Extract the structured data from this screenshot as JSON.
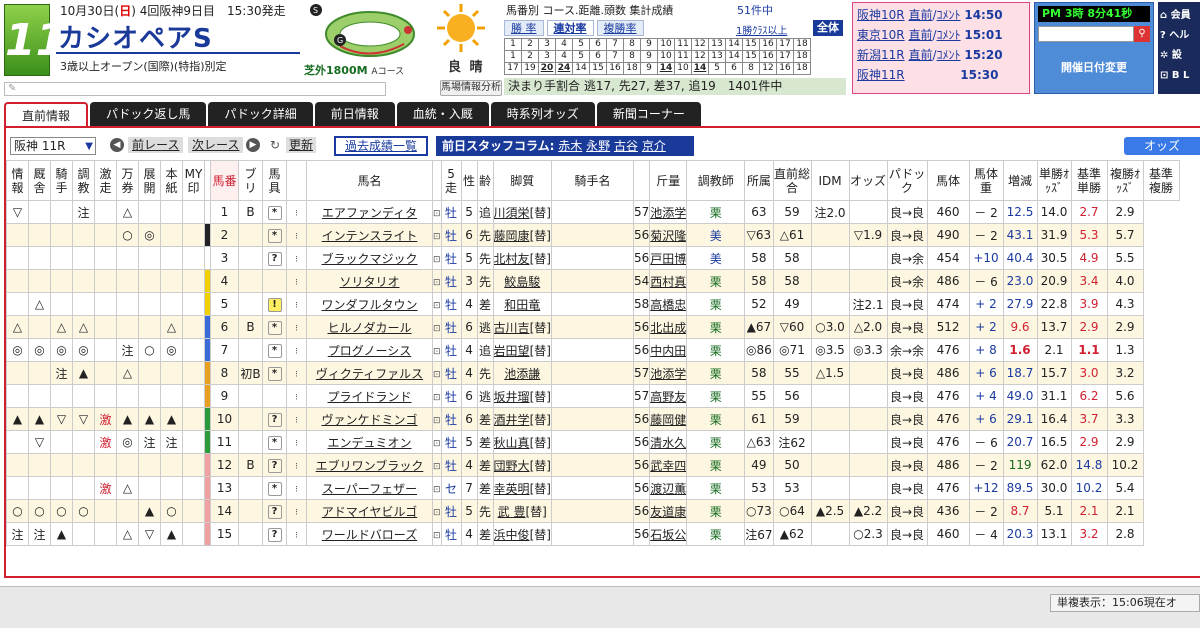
{
  "header": {
    "race_number": "11",
    "date_prefix": "10月30日(",
    "day": "日",
    "date_suffix": ") 4回阪神9日目　15:30発走",
    "race_name": "カシオペアS",
    "condition": "3歳以上オープン(国際)(特指)別定",
    "course": "芝外1800M",
    "course_sub": "Aコース",
    "weather": "良 晴"
  },
  "stats": {
    "heading": "馬番別 コース.距離.頭数 集計成績",
    "count": "51件中",
    "tabs": [
      "勝 率",
      "連対率",
      "複勝率"
    ],
    "class_link": "1勝ｸﾗｽ以上",
    "all_label": "全体",
    "grid_row1": [
      "1",
      "2",
      "3",
      "4",
      "5",
      "6",
      "7",
      "8",
      "9",
      "10",
      "11",
      "12",
      "13",
      "14",
      "15",
      "16",
      "17",
      "18"
    ],
    "grid_row2": [
      "1",
      "2",
      "3",
      "4",
      "5",
      "6",
      "7",
      "8",
      "9",
      "10",
      "11",
      "12",
      "13",
      "14",
      "15",
      "16",
      "17",
      "18"
    ],
    "grid_row3": [
      "17",
      "19",
      "20",
      "24",
      "14",
      "15",
      "16",
      "18",
      "9",
      "14",
      "10",
      "14",
      "5",
      "6",
      "8",
      "12",
      "16",
      "18"
    ],
    "pace": "決まり手割合 逃17, 先27, 差37, 追19　1401件中",
    "baba_button": "馬場情報分析"
  },
  "race_links": [
    {
      "track": "阪神10R",
      "a": "直前",
      "b": "ｺﾒﾝﾄ",
      "time": "14:50"
    },
    {
      "track": "東京10R",
      "a": "直前",
      "b": "ｺﾒﾝﾄ",
      "time": "15:01"
    },
    {
      "track": "新潟11R",
      "a": "直前",
      "b": "ｺﾒﾝﾄ",
      "time": "15:20"
    },
    {
      "track": "阪神11R",
      "a": "",
      "b": "",
      "time": "15:30"
    }
  ],
  "clock": "PM 3時 8分41秒",
  "date_change": "開催日付変更",
  "side_menu": [
    "⌂ 会員",
    "? ヘル",
    "✲ 設",
    "⊡ B L"
  ],
  "tabs": [
    "直前情報",
    "パドック返し馬",
    "パドック詳細",
    "前日情報",
    "血統・入厩",
    "時系列オッズ",
    "新聞コーナー"
  ],
  "toolbar": {
    "race_select": "阪神 11R",
    "prev": "前レース",
    "next": "次レース",
    "refresh": "更新",
    "past": "過去成績一覧",
    "staff_label": "前日スタッフコラム:",
    "staff": [
      "赤木",
      "永野",
      "古谷",
      "京介"
    ],
    "odds": "オッズ"
  },
  "table_headers": [
    "情報",
    "厩舎",
    "騎手",
    "調教",
    "激走",
    "万券",
    "展開",
    "本紙",
    "MY印",
    "",
    "馬番",
    "ブリ",
    "馬具",
    "",
    "馬名",
    "",
    "5走",
    "性",
    "齢",
    "脚質",
    "騎手名",
    "",
    "斤量",
    "調教師",
    "所属",
    "直前総合",
    "IDM",
    "オッズ",
    "パドック",
    "馬体",
    "馬体重",
    "増減",
    "単勝ｵｯｽﾞ",
    "基準単勝",
    "複勝ｵｯｽﾞ",
    "基準複勝"
  ],
  "rows": [
    {
      "m": [
        "▽",
        "",
        "",
        "注",
        "",
        "△",
        "",
        "",
        ""
      ],
      "waku": "#ffffff",
      "no": "1",
      "bl": "B",
      "k": "*",
      "name": "エアファンディタ",
      "sex": "牡",
      "age": "5",
      "style": "追",
      "jockey": "川須栄",
      "jt": "替",
      "kin": "57",
      "trainer": "池添学",
      "tb": "栗",
      "sogo": "63",
      "idm": "59",
      "odds": "注2.0",
      "pad": "",
      "body": "良→良",
      "weight": "460",
      "diff": "－ 2",
      "win": "12.5",
      "bwin": "14.0",
      "place": "2.7",
      "bplace": "2.9",
      "wc": "blue",
      "pc": "red"
    },
    {
      "m": [
        "",
        "",
        "",
        "",
        "",
        "○",
        "◎",
        "",
        ""
      ],
      "waku": "#222222",
      "no": "2",
      "bl": "",
      "k": "*",
      "name": "インテンスライト",
      "sex": "牡",
      "age": "6",
      "style": "先",
      "jockey": "藤岡康",
      "jt": "替",
      "kin": "56",
      "trainer": "菊沢隆",
      "tb": "美",
      "sogo": "▽63",
      "idm": "△61",
      "odds": "",
      "pad": "▽1.9",
      "body": "良→良",
      "weight": "490",
      "diff": "－ 2",
      "win": "43.1",
      "bwin": "31.9",
      "place": "5.3",
      "bplace": "5.7",
      "wc": "blue",
      "pc": "red"
    },
    {
      "m": [
        "",
        "",
        "",
        "",
        "",
        "",
        "",
        "",
        ""
      ],
      "waku": "#ffffff",
      "no": "3",
      "bl": "",
      "k": "?",
      "name": "ブラックマジック",
      "sex": "牡",
      "age": "5",
      "style": "先",
      "jockey": "北村友",
      "jt": "替",
      "kin": "56",
      "trainer": "戸田博",
      "tb": "美",
      "sogo": "58",
      "idm": "58",
      "odds": "",
      "pad": "",
      "body": "良→余",
      "weight": "454",
      "diff": "+10",
      "win": "40.4",
      "bwin": "30.5",
      "place": "4.9",
      "bplace": "5.5",
      "wc": "blue",
      "pc": "red"
    },
    {
      "m": [
        "",
        "",
        "",
        "",
        "",
        "",
        "",
        "",
        ""
      ],
      "waku": "#f0d000",
      "no": "4",
      "bl": "",
      "k": "",
      "name": "ソリタリオ",
      "sex": "牡",
      "age": "3",
      "style": "先",
      "jockey": "鮫島駿",
      "jt": "",
      "kin": "54",
      "trainer": "西村真",
      "tb": "栗",
      "sogo": "58",
      "idm": "58",
      "odds": "",
      "pad": "",
      "body": "良→余",
      "weight": "486",
      "diff": "－ 6",
      "win": "23.0",
      "bwin": "20.9",
      "place": "3.4",
      "bplace": "4.0",
      "wc": "blue",
      "pc": "red"
    },
    {
      "m": [
        "",
        "△",
        "",
        "",
        "",
        "",
        "",
        "",
        ""
      ],
      "waku": "#f0d000",
      "no": "5",
      "bl": "",
      "k": "!",
      "name": "ワンダフルタウン",
      "sex": "牡",
      "age": "4",
      "style": "差",
      "jockey": "和田竜",
      "jt": "",
      "kin": "58",
      "trainer": "高橋忠",
      "tb": "栗",
      "sogo": "52",
      "idm": "49",
      "odds": "",
      "pad": "注2.1",
      "body": "良→良",
      "weight": "474",
      "diff": "+ 2",
      "win": "27.9",
      "bwin": "22.8",
      "place": "3.9",
      "bplace": "4.3",
      "wc": "blue",
      "pc": "red"
    },
    {
      "m": [
        "△",
        "",
        "△",
        "△",
        "",
        "",
        "",
        "△",
        ""
      ],
      "waku": "#3a6ad8",
      "no": "6",
      "bl": "B",
      "k": "*",
      "name": "ヒルノダカール",
      "sex": "牡",
      "age": "6",
      "style": "逃",
      "jockey": "古川吉",
      "jt": "替",
      "kin": "56",
      "trainer": "北出成",
      "tb": "栗",
      "sogo": "▲67",
      "idm": "▽60",
      "odds": "○3.0",
      "pad": "△2.0",
      "body": "良→良",
      "weight": "512",
      "diff": "+ 2",
      "win": "9.6",
      "bwin": "13.7",
      "place": "2.9",
      "bplace": "2.9",
      "wc": "red",
      "pc": "red"
    },
    {
      "m": [
        "◎",
        "◎",
        "◎",
        "◎",
        "",
        "注",
        "○",
        "◎",
        ""
      ],
      "waku": "#3a6ad8",
      "no": "7",
      "bl": "",
      "k": "*",
      "name": "プログノーシス",
      "sex": "牡",
      "age": "4",
      "style": "追",
      "jockey": "岩田望",
      "jt": "替",
      "kin": "56",
      "trainer": "中内田",
      "tb": "栗",
      "sogo": "◎86",
      "idm": "◎71",
      "odds": "◎3.5",
      "pad": "◎3.3",
      "body": "余→余",
      "weight": "476",
      "diff": "+ 8",
      "win": "1.6",
      "bwin": "2.1",
      "place": "1.1",
      "bplace": "1.3",
      "wc": "redb",
      "pc": "redb"
    },
    {
      "m": [
        "",
        "",
        "注",
        "▲",
        "",
        "△",
        "",
        "",
        ""
      ],
      "waku": "#e8a020",
      "no": "8",
      "bl": "初B",
      "k": "*",
      "name": "ヴィクティファルス",
      "sex": "牡",
      "age": "4",
      "style": "先",
      "jockey": "池添謙",
      "jt": "",
      "kin": "57",
      "trainer": "池添学",
      "tb": "栗",
      "sogo": "58",
      "idm": "55",
      "odds": "△1.5",
      "pad": "",
      "body": "良→良",
      "weight": "486",
      "diff": "+ 6",
      "win": "18.7",
      "bwin": "15.7",
      "place": "3.0",
      "bplace": "3.2",
      "wc": "blue",
      "pc": "red"
    },
    {
      "m": [
        "",
        "",
        "",
        "",
        "",
        "",
        "",
        "",
        ""
      ],
      "waku": "#e8a020",
      "no": "9",
      "bl": "",
      "k": "",
      "name": "プライドランド",
      "sex": "牡",
      "age": "6",
      "style": "逃",
      "jockey": "坂井瑠",
      "jt": "替",
      "kin": "57",
      "trainer": "高野友",
      "tb": "栗",
      "sogo": "55",
      "idm": "56",
      "odds": "",
      "pad": "",
      "body": "良→良",
      "weight": "476",
      "diff": "+ 4",
      "win": "49.0",
      "bwin": "31.1",
      "place": "6.2",
      "bplace": "5.6",
      "wc": "blue",
      "pc": "red"
    },
    {
      "m": [
        "▲",
        "▲",
        "▽",
        "▽",
        "激",
        "▲",
        "▲",
        "▲",
        ""
      ],
      "waku": "#2a9a3a",
      "no": "10",
      "bl": "",
      "k": "?",
      "name": "ヴァンケドミンゴ",
      "sex": "牡",
      "age": "6",
      "style": "差",
      "jockey": "酒井学",
      "jt": "替",
      "kin": "56",
      "trainer": "藤岡健",
      "tb": "栗",
      "sogo": "61",
      "idm": "59",
      "odds": "",
      "pad": "",
      "body": "良→良",
      "weight": "476",
      "diff": "+ 6",
      "win": "29.1",
      "bwin": "16.4",
      "place": "3.7",
      "bplace": "3.3",
      "wc": "blue",
      "pc": "red"
    },
    {
      "m": [
        "",
        "▽",
        "",
        "",
        "激",
        "◎",
        "注",
        "注",
        ""
      ],
      "waku": "#2a9a3a",
      "no": "11",
      "bl": "",
      "k": "*",
      "name": "エンデュミオン",
      "sex": "牡",
      "age": "5",
      "style": "差",
      "jockey": "秋山真",
      "jt": "替",
      "kin": "56",
      "trainer": "清水久",
      "tb": "栗",
      "sogo": "△63",
      "idm": "注62",
      "odds": "",
      "pad": "",
      "body": "良→良",
      "weight": "476",
      "diff": "－ 6",
      "win": "20.7",
      "bwin": "16.5",
      "place": "2.9",
      "bplace": "2.9",
      "wc": "blue",
      "pc": "red"
    },
    {
      "m": [
        "",
        "",
        "",
        "",
        "",
        "",
        "",
        "",
        ""
      ],
      "waku": "#f0a0a0",
      "no": "12",
      "bl": "B",
      "k": "?",
      "name": "エブリワンブラック",
      "sex": "牡",
      "age": "4",
      "style": "差",
      "jockey": "団野大",
      "jt": "替",
      "kin": "56",
      "trainer": "武幸四",
      "tb": "栗",
      "sogo": "49",
      "idm": "50",
      "odds": "",
      "pad": "",
      "body": "良→良",
      "weight": "486",
      "diff": "－ 2",
      "win": "119",
      "bwin": "62.0",
      "place": "14.8",
      "bplace": "10.2",
      "wc": "green",
      "pc": "blue"
    },
    {
      "m": [
        "",
        "",
        "",
        "",
        "激",
        "△",
        "",
        "",
        ""
      ],
      "waku": "#f0a0a0",
      "no": "13",
      "bl": "",
      "k": "*",
      "name": "スーパーフェザー",
      "sex": "セ",
      "age": "7",
      "style": "差",
      "jockey": "幸英明",
      "jt": "替",
      "kin": "56",
      "trainer": "渡辺薫",
      "tb": "栗",
      "sogo": "53",
      "idm": "53",
      "odds": "",
      "pad": "",
      "body": "良→良",
      "weight": "476",
      "diff": "+12",
      "win": "89.5",
      "bwin": "30.0",
      "place": "10.2",
      "bplace": "5.4",
      "wc": "blue",
      "pc": "blue"
    },
    {
      "m": [
        "○",
        "○",
        "○",
        "○",
        "",
        "",
        "▲",
        "○",
        ""
      ],
      "waku": "#f0a0a0",
      "no": "14",
      "bl": "",
      "k": "?",
      "name": "アドマイヤビルゴ",
      "sex": "牡",
      "age": "5",
      "style": "先",
      "jockey": "武 豊",
      "jt": "替",
      "kin": "56",
      "trainer": "友道康",
      "tb": "栗",
      "sogo": "○73",
      "idm": "○64",
      "odds": "▲2.5",
      "pad": "▲2.2",
      "body": "良→良",
      "weight": "436",
      "diff": "－ 2",
      "win": "8.7",
      "bwin": "5.1",
      "place": "2.1",
      "bplace": "2.1",
      "wc": "red",
      "pc": "red"
    },
    {
      "m": [
        "注",
        "注",
        "▲",
        "",
        "",
        "△",
        "▽",
        "▲",
        ""
      ],
      "waku": "#f0a0a0",
      "no": "15",
      "bl": "",
      "k": "?",
      "name": "ワールドバローズ",
      "sex": "牡",
      "age": "4",
      "style": "差",
      "jockey": "浜中俊",
      "jt": "替",
      "kin": "56",
      "trainer": "石坂公",
      "tb": "栗",
      "sogo": "注67",
      "idm": "▲62",
      "odds": "",
      "pad": "○2.3",
      "body": "良→良",
      "weight": "460",
      "diff": "－ 4",
      "win": "20.3",
      "bwin": "13.1",
      "place": "3.2",
      "bplace": "2.8",
      "wc": "blue",
      "pc": "red"
    }
  ],
  "footer": {
    "status": "単複表示：15:06現在オ"
  }
}
